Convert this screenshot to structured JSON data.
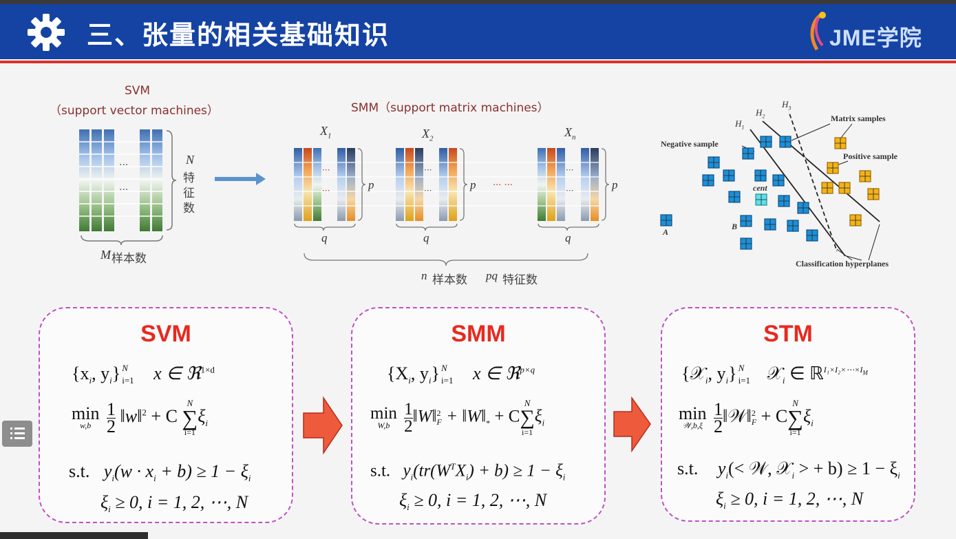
{
  "header": {
    "title": "三、张量的相关基础知识",
    "logo_text": "JME学院"
  },
  "svm_diagram": {
    "title": "SVM",
    "subtitle": "（support vector machines）",
    "side_label_n": "N",
    "side_label_cn": [
      "特",
      "征",
      "数"
    ],
    "bottom_label_m": "M",
    "bottom_label_cn": "样本数"
  },
  "smm_diagram": {
    "title": "SMM（support matrix machines）",
    "matrices": [
      {
        "label": "X",
        "sub": "1"
      },
      {
        "label": "X",
        "sub": "2"
      },
      {
        "label": "X",
        "sub": "n"
      }
    ],
    "p_label": "p",
    "q_label": "q",
    "bottom_n": "n",
    "bottom_n_cn": "样本数",
    "bottom_pq": "pq",
    "bottom_pq_cn": "特征数"
  },
  "scatter_diagram": {
    "H1": "H",
    "H2": "H",
    "H3": "H",
    "H1_sub": "1",
    "H2_sub": "2",
    "H3_sub": "3",
    "negative_sample": "Negative sample",
    "matrix_samples": "Matrix samples",
    "positive_sample": "Positive sample",
    "cent": "cent",
    "A": "A",
    "B": "B",
    "classification_hyperplanes": "Classification hyperplanes"
  },
  "boxes": {
    "svm": {
      "title": "SVM",
      "line1": "{x_i, y_i}_{i=1}^N    x ∈ ℜ^{1×d}",
      "line2": "min_{w,b} ½‖w‖² + C Σ_{i=1}^N ξ_i",
      "line3": "s.t.  y_i(w·x_i + b) ≥ 1 − ξ_i",
      "line4": "ξ_i ≥ 0, i = 1,2,⋯,N"
    },
    "smm": {
      "title": "SMM",
      "line1": "{X_i, y_i}_{i=1}^N    x ∈ ℜ^{p×q}",
      "line2": "min_{W,b} ½‖W‖_F² + ‖W‖_* + C Σ_{i=1}^N ξ_i",
      "line3": "s.t.  y_i(tr(W^T X_i) + b) ≥ 1 − ξ_i",
      "line4": "ξ_i ≥ 0, i = 1,2,⋯,N"
    },
    "stm": {
      "title": "STM",
      "line1": "{𝒳_i, y_i}_{i=1}^N    𝒳_i ∈ ℝ^{I1×I2×⋯×IM}",
      "line2": "min_{𝒲,b,ξ} ½‖𝒲‖_F² + C Σ_{i=1}^N ξ_i",
      "line3": "s.t.  y_i(<𝒲,𝒳_i> + b) ≥ 1 − ξ_i",
      "line4": "ξ_i ≥ 0, i = 1,2,⋯,N"
    }
  },
  "math_text": {
    "svm_set": "{x",
    "svm_y": ", y",
    "svm_close": "}",
    "svm_sub_i": "i",
    "svm_sup_N": "N",
    "svm_sub_i1": "i=1",
    "svm_x_in": "x ∈ ℜ",
    "svm_dim": "1×d",
    "min": "min",
    "svm_min_sub": "w,b",
    "half_num": "1",
    "half_den": "2",
    "svm_norm": "‖w‖",
    "sq": "2",
    "plus_C": "+ C",
    "sigma": "∑",
    "xi": "ξ",
    "i": "i",
    "N": "N",
    "i1": "i=1",
    "st": "s.t.",
    "svm_st": "y",
    "svm_st_rest": "(w · x",
    "svm_st_rest2": " + b) ≥ 1 − ξ",
    "nonneg": " ≥ 0, i = 1, 2, ⋯, N",
    "smm_set": "{X",
    "smm_x_in": "x ∈ ℜ",
    "smm_dim": "p×q",
    "smm_min_sub": "W,b",
    "smm_norm": "‖W‖",
    "F": "F",
    "smm_nuc": "+ ‖W‖",
    "star": "*",
    "smm_st_rest": "(tr(W",
    "T": "T",
    "smm_st_rest2": "X",
    "smm_st_rest3": ") + b) ≥ 1 − ξ",
    "stm_set": "{𝒳",
    "stm_x_in": "𝒳",
    "stm_in": " ∈ ℝ",
    "stm_dim": "I₁×I₂×⋯×I",
    "stm_dim_M": "M",
    "stm_min_sub": "𝒲,b,ξ",
    "stm_norm": "‖𝒲‖",
    "stm_st_rest": "(< 𝒲, 𝒳",
    "stm_st_rest2": " > + b) ≥ 1 − ξ"
  },
  "dots": "···",
  "dots_row": "··· ···",
  "colors": {
    "header_bg": "#1543a3",
    "accent_red": "#e8291f",
    "dashed_border": "#c04fc4",
    "label_dark_red": "#8a2f2f",
    "neg_sample": "#1e8fd6",
    "pos_sample": "#f2b21a"
  },
  "icons": [
    "gear-icon",
    "logo-icon",
    "menu-icon",
    "arrow-right-icon"
  ]
}
